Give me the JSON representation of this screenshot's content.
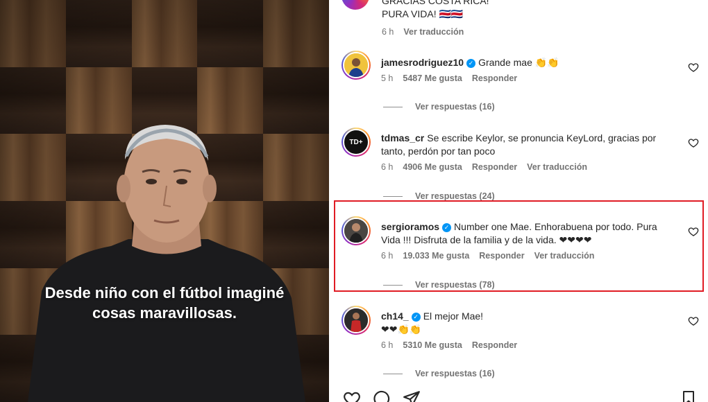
{
  "video": {
    "caption_line1": "Desde niño con el fútbol imaginé",
    "caption_line2": "cosas maravillosas."
  },
  "prev_comment": {
    "text_line1": "GRACIAS COSTA RICA!",
    "text_line2": "PURA VIDA! 🇨🇷🇨🇷",
    "time": "6 h",
    "translate": "Ver traducción"
  },
  "comments": [
    {
      "username": "jamesrodriguez10",
      "verified": true,
      "text": "Grande mae 👏👏",
      "time": "5 h",
      "likes": "5487 Me gusta",
      "reply": "Responder",
      "translate": "",
      "replies": "Ver respuestas (16)",
      "avatar_label": "",
      "avatar_color": "#e3b52a"
    },
    {
      "username": "tdmas_cr",
      "verified": false,
      "text": "Se escribe Keylor, se pronuncia KeyLord, gracias por tanto, perdón por tan poco",
      "time": "6 h",
      "likes": "4906 Me gusta",
      "reply": "Responder",
      "translate": "Ver traducción",
      "replies": "Ver respuestas (24)",
      "avatar_label": "TD+",
      "avatar_color": "#111111"
    },
    {
      "username": "sergioramos",
      "verified": true,
      "text": "Number one Mae. Enhorabuena por todo. Pura Vida !!! Disfruta de la familia y de la vida. ❤❤❤❤",
      "time": "6 h",
      "likes": "19.033 Me gusta",
      "reply": "Responder",
      "translate": "Ver traducción",
      "replies": "Ver respuestas (78)",
      "avatar_label": "",
      "avatar_color": "#3a3a3a"
    },
    {
      "username": "ch14_",
      "verified": true,
      "text": "El mejor Mae!",
      "text_line2": "❤❤👏👏",
      "time": "6 h",
      "likes": "5310 Me gusta",
      "reply": "Responder",
      "translate": "",
      "replies": "Ver respuestas (16)",
      "avatar_label": "",
      "avatar_color": "#8b1e24"
    }
  ],
  "icons": [
    "heart-icon",
    "comment-icon",
    "share-icon",
    "bookmark-icon",
    "verified-icon"
  ],
  "colors": {
    "highlight": "#e01b24",
    "verified": "#0095f6",
    "meta_gray": "#737373"
  }
}
